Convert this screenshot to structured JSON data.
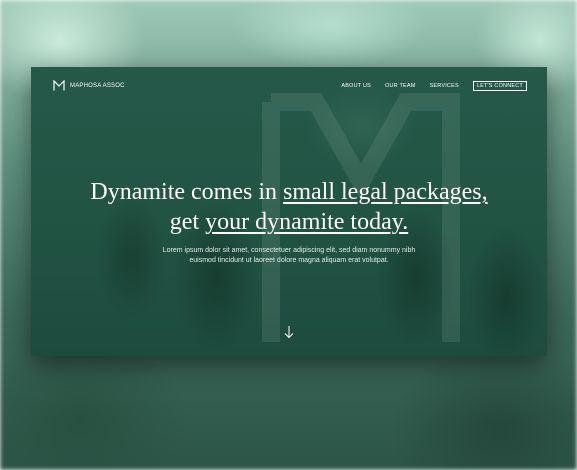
{
  "brand": {
    "name": "MAPHOSA ASSOC",
    "logo_letter": "M"
  },
  "nav": {
    "items": [
      {
        "label": "ABOUT US"
      },
      {
        "label": "OUR TEAM"
      },
      {
        "label": "SERVICES"
      }
    ],
    "cta_label": "LET'S CONNECT"
  },
  "hero": {
    "line1_plain": "Dynamite comes in ",
    "line1_underlined": "small legal packages,",
    "line2_plain": "get ",
    "line2_underlined": "your dynamite today.",
    "lede": "Lorem ipsum dolor sit amet, consectetuer adipiscing elit, sed diam nonummy nibh euismod tincidunt ut laoreet dolore magna aliquam erat volutpat."
  },
  "icons": {
    "scroll": "arrow-down-icon",
    "logo": "m-logo-icon"
  },
  "colors": {
    "overlay": "#285b4a",
    "text": "#ffffff",
    "backdrop": "#5f8f7e"
  }
}
